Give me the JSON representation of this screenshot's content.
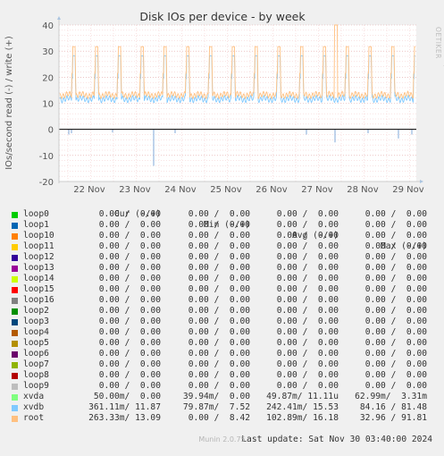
{
  "chart_data": {
    "type": "line",
    "title": "Disk IOs per device - by week",
    "ylabel": "IOs/second read (-) / write (+)",
    "xlabel": "",
    "ylim": [
      -20,
      40
    ],
    "yticks": [
      "40",
      "30",
      "20",
      "10",
      "0",
      "-10",
      "-20"
    ],
    "xticks": [
      "22 Nov",
      "23 Nov",
      "24 Nov",
      "25 Nov",
      "26 Nov",
      "27 Nov",
      "28 Nov",
      "29 Nov"
    ],
    "grid": true,
    "series_summary": "write (+) series xvdb and root: baseline about 11-14 with two daily spikes reaching about 28-32; one spike on 28 Nov reaches about 40. read (-) series: mostly 0 to -3 with a dip to about -14 on 23 Nov.",
    "series": [
      {
        "name": "loop0",
        "color": "#00cc00",
        "cur": "0.00 /  0.00",
        "min": "0.00 /  0.00",
        "avg": "0.00 /  0.00",
        "max": "0.00 /  0.00"
      },
      {
        "name": "loop1",
        "color": "#0066b3",
        "cur": "0.00 /  0.00",
        "min": "0.00 /  0.00",
        "avg": "0.00 /  0.00",
        "max": "0.00 /  0.00"
      },
      {
        "name": "loop10",
        "color": "#ff8000",
        "cur": "0.00 /  0.00",
        "min": "0.00 /  0.00",
        "avg": "0.00 /  0.00",
        "max": "0.00 /  0.00"
      },
      {
        "name": "loop11",
        "color": "#ffcc00",
        "cur": "0.00 /  0.00",
        "min": "0.00 /  0.00",
        "avg": "0.00 /  0.00",
        "max": "0.00 /  0.00"
      },
      {
        "name": "loop12",
        "color": "#330099",
        "cur": "0.00 /  0.00",
        "min": "0.00 /  0.00",
        "avg": "0.00 /  0.00",
        "max": "0.00 /  0.00"
      },
      {
        "name": "loop13",
        "color": "#990099",
        "cur": "0.00 /  0.00",
        "min": "0.00 /  0.00",
        "avg": "0.00 /  0.00",
        "max": "0.00 /  0.00"
      },
      {
        "name": "loop14",
        "color": "#ccff00",
        "cur": "0.00 /  0.00",
        "min": "0.00 /  0.00",
        "avg": "0.00 /  0.00",
        "max": "0.00 /  0.00"
      },
      {
        "name": "loop15",
        "color": "#ff0000",
        "cur": "0.00 /  0.00",
        "min": "0.00 /  0.00",
        "avg": "0.00 /  0.00",
        "max": "0.00 /  0.00"
      },
      {
        "name": "loop16",
        "color": "#808080",
        "cur": "0.00 /  0.00",
        "min": "0.00 /  0.00",
        "avg": "0.00 /  0.00",
        "max": "0.00 /  0.00"
      },
      {
        "name": "loop2",
        "color": "#008f00",
        "cur": "0.00 /  0.00",
        "min": "0.00 /  0.00",
        "avg": "0.00 /  0.00",
        "max": "0.00 /  0.00"
      },
      {
        "name": "loop3",
        "color": "#00487d",
        "cur": "0.00 /  0.00",
        "min": "0.00 /  0.00",
        "avg": "0.00 /  0.00",
        "max": "0.00 /  0.00"
      },
      {
        "name": "loop4",
        "color": "#b35a00",
        "cur": "0.00 /  0.00",
        "min": "0.00 /  0.00",
        "avg": "0.00 /  0.00",
        "max": "0.00 /  0.00"
      },
      {
        "name": "loop5",
        "color": "#b38f00",
        "cur": "0.00 /  0.00",
        "min": "0.00 /  0.00",
        "avg": "0.00 /  0.00",
        "max": "0.00 /  0.00"
      },
      {
        "name": "loop6",
        "color": "#6b006b",
        "cur": "0.00 /  0.00",
        "min": "0.00 /  0.00",
        "avg": "0.00 /  0.00",
        "max": "0.00 /  0.00"
      },
      {
        "name": "loop7",
        "color": "#8fb300",
        "cur": "0.00 /  0.00",
        "min": "0.00 /  0.00",
        "avg": "0.00 /  0.00",
        "max": "0.00 /  0.00"
      },
      {
        "name": "loop8",
        "color": "#b30000",
        "cur": "0.00 /  0.00",
        "min": "0.00 /  0.00",
        "avg": "0.00 /  0.00",
        "max": "0.00 /  0.00"
      },
      {
        "name": "loop9",
        "color": "#bebebe",
        "cur": "0.00 /  0.00",
        "min": "0.00 /  0.00",
        "avg": "0.00 /  0.00",
        "max": "0.00 /  0.00"
      },
      {
        "name": "xvda",
        "color": "#80ff80",
        "cur": "50.00m/  0.00",
        "min": "39.94m/  0.00",
        "avg": "49.87m/ 11.11u",
        "max": "62.99m/  3.31m"
      },
      {
        "name": "xvdb",
        "color": "#80c9ff",
        "cur": "361.11m/ 11.87",
        "min": "79.87m/  7.52",
        "avg": "242.41m/ 15.53",
        "max": "84.16 / 81.48"
      },
      {
        "name": "root",
        "color": "#ffc080",
        "cur": "263.33m/ 13.09",
        "min": "0.00 /  8.42",
        "avg": "102.89m/ 16.18",
        "max": "32.96 / 91.81"
      }
    ]
  },
  "legend_headers": {
    "cur": "Cur (-/+)",
    "min": "Min (-/+)",
    "avg": "Avg (-/+)",
    "max": "Max (-/+)"
  },
  "last_update": "Last update: Sat Nov 30 03:40:00 2024",
  "side_label": "RRDTOOL / TOBI OETIKER",
  "footer": "Munin 2.0.75"
}
